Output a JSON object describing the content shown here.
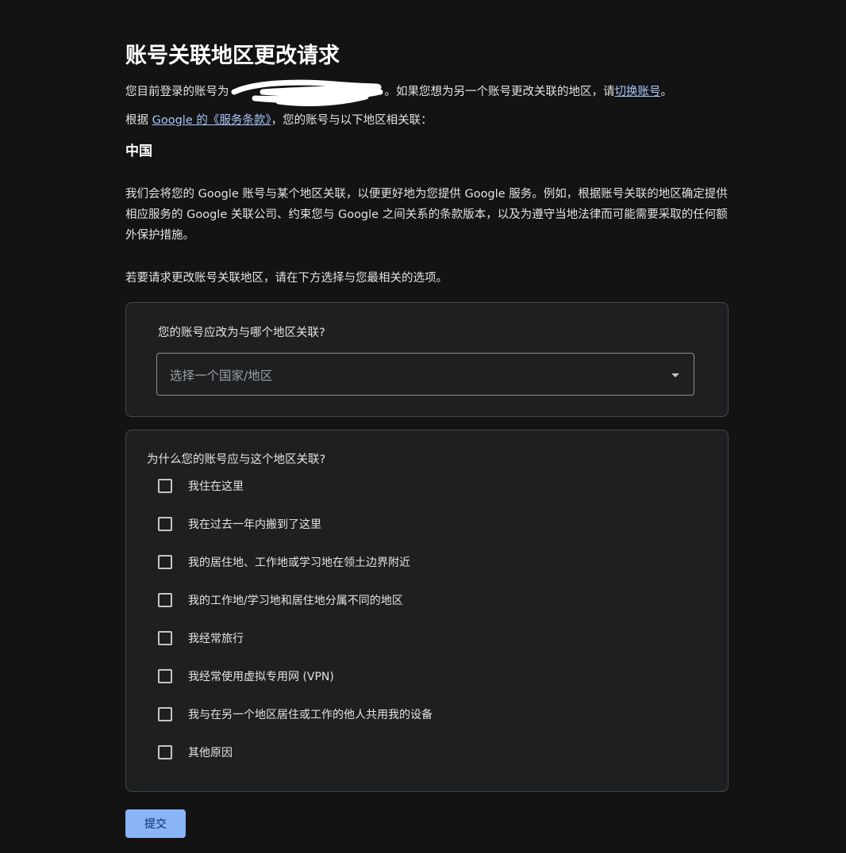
{
  "page": {
    "title": "账号关联地区更改请求",
    "login_prefix": "您目前登录的账号为",
    "login_suffix": "。如果您想为另一个账号更改关联的地区，请",
    "switch_link": "切换账号",
    "login_end": "。",
    "terms_prefix": "根据 ",
    "terms_link": "Google 的《服务条款》",
    "terms_suffix": "，您的账号与以下地区相关联：",
    "current_region": "中国",
    "description": "我们会将您的 Google 账号与某个地区关联，以便更好地为您提供 Google 服务。例如，根据账号关联的地区确定提供相应服务的 Google 关联公司、约束您与 Google 之间关系的条款版本，以及为遵守当地法律而可能需要采取的任何额外保护措施。",
    "instruction": "若要请求更改账号关联地区，请在下方选择与您最相关的选项。"
  },
  "region_card": {
    "question": "您的账号应改为与哪个地区关联?",
    "select_placeholder": "选择一个国家/地区"
  },
  "reason_card": {
    "question": "为什么您的账号应与这个地区关联?",
    "options": [
      {
        "label": "我住在这里",
        "checked": false
      },
      {
        "label": "我在过去一年内搬到了这里",
        "checked": false
      },
      {
        "label": "我的居住地、工作地或学习地在领土边界附近",
        "checked": false
      },
      {
        "label": "我的工作地/学习地和居住地分属不同的地区",
        "checked": false
      },
      {
        "label": "我经常旅行",
        "checked": false
      },
      {
        "label": "我经常使用虚拟专用网 (VPN)",
        "checked": false
      },
      {
        "label": "我与在另一个地区居住或工作的他人共用我的设备",
        "checked": false
      },
      {
        "label": "其他原因",
        "checked": false
      }
    ]
  },
  "actions": {
    "submit_label": "提交"
  },
  "colors": {
    "background": "#131314",
    "card": "#1e1f20",
    "link": "#a8c7fa",
    "button": "#8ab4f8"
  }
}
